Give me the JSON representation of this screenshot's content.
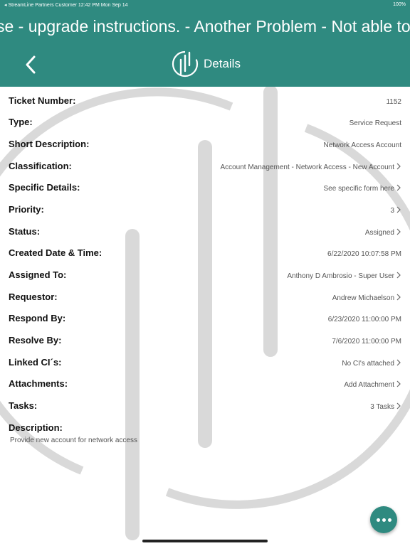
{
  "status_bar": {
    "left": "◂ StreamLine Partners Customer   12:42 PM   Mon Sep 14",
    "right": "100%"
  },
  "marquee_text": "se - upgrade instructions. - Another Problem - Not able to C",
  "nav": {
    "title": "Details",
    "back_icon": "chevron-left-icon",
    "logo_icon": "app-logo-icon"
  },
  "fields": [
    {
      "label": "Ticket Number:",
      "value": "1152",
      "chevron": false
    },
    {
      "label": "Type:",
      "value": "Service Request",
      "chevron": false
    },
    {
      "label": "Short Description:",
      "value": "Network Access Account",
      "chevron": false
    },
    {
      "label": "Classification:",
      "value": "Account Management - Network Access - New Account",
      "chevron": true
    },
    {
      "label": "Specific Details:",
      "value": "See specific form here",
      "chevron": true
    },
    {
      "label": "Priority:",
      "value": "3",
      "chevron": true
    },
    {
      "label": "Status:",
      "value": "Assigned",
      "chevron": true
    },
    {
      "label": "Created Date & Time:",
      "value": "6/22/2020 10:07:58 PM",
      "chevron": false
    },
    {
      "label": "Assigned To:",
      "value": "Anthony D Ambrosio - Super User",
      "chevron": true
    },
    {
      "label": "Requestor:",
      "value": "Andrew Michaelson",
      "chevron": true
    },
    {
      "label": "Respond By:",
      "value": "6/23/2020 11:00:00 PM",
      "chevron": false
    },
    {
      "label": "Resolve By:",
      "value": "7/6/2020 11:00:00 PM",
      "chevron": false
    },
    {
      "label": "Linked CI´s:",
      "value": "No CI's attached",
      "chevron": true
    },
    {
      "label": "Attachments:",
      "value": "Add Attachment",
      "chevron": true
    },
    {
      "label": "Tasks:",
      "value": "3 Tasks",
      "chevron": true
    },
    {
      "label": "Description:",
      "value": "",
      "chevron": false
    }
  ],
  "description": "Provide new account for network access",
  "fab_icon": "more-options-icon",
  "colors": {
    "primary": "#2f8a80",
    "watermark": "#d9d9d9"
  }
}
